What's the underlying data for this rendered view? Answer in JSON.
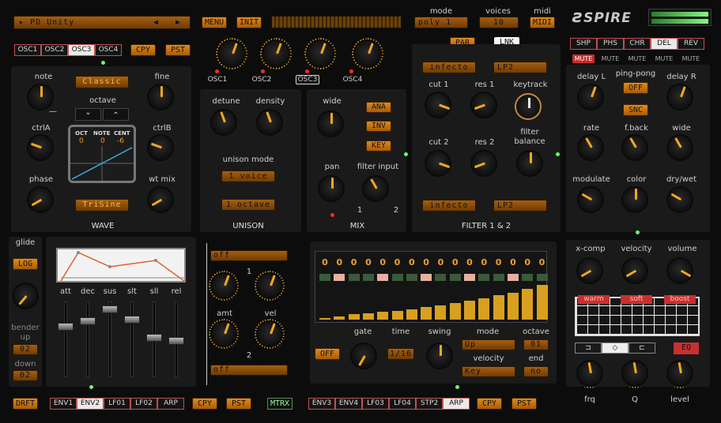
{
  "header": {
    "preset": "PD Unity",
    "menu": "MENU",
    "init": "INIT",
    "mode_label": "mode",
    "mode_value": "poly 1",
    "voices_label": "voices",
    "voices_value": "10",
    "midi_label": "midi",
    "midi_value": "MIDI",
    "logo": "SPIRE"
  },
  "osc": {
    "tabs": [
      "OSC1",
      "OSC2",
      "OSC3",
      "OSC4"
    ],
    "selected": 2,
    "copy": "CPY",
    "paste": "PST",
    "note": "note",
    "classic": "Classic",
    "fine": "fine",
    "octave": "octave",
    "ctrlA": "ctrlA",
    "ctrlB": "ctrlB",
    "phase": "phase",
    "wtmix": "wt mix",
    "trisine": "TriSine",
    "wave": "WAVE",
    "oct_h": "OCT",
    "note_h": "NOTE",
    "cent_h": "CENT",
    "oct_v": "0",
    "note_v": "0",
    "cent_v": "-6",
    "down_arrow": "⌄",
    "up_arrow": "⌃",
    "dash": "—"
  },
  "osc_sel": {
    "labels": [
      "OSC1",
      "OSC2",
      "OSC3",
      "OSC4"
    ]
  },
  "unison": {
    "detune": "detune",
    "density": "density",
    "mode_label": "unison mode",
    "voice": "1 voice",
    "octave": "1 octave",
    "title": "UNISON"
  },
  "mix": {
    "wide": "wide",
    "ana": "ANA",
    "inv": "INV",
    "key": "KEY",
    "pan": "pan",
    "filter_input": "filter input",
    "one": "1",
    "two": "2",
    "title": "MIX"
  },
  "filter": {
    "par": "PAR",
    "lnk": "LNK",
    "type1": "infecto",
    "mode1": "LP2",
    "cut1": "cut 1",
    "res1": "res 1",
    "keytrack": "keytrack",
    "cut2": "cut 2",
    "res2": "res 2",
    "filter_balance": "filter balance",
    "type2": "infecto",
    "mode2": "LP2",
    "title": "FILTER 1 & 2"
  },
  "fx": {
    "tabs": [
      "SHP",
      "PHS",
      "CHR",
      "DEL",
      "REV"
    ],
    "selected": 3,
    "mute_labels": [
      "MUTE",
      "MUTE",
      "MUTE",
      "MUTE",
      "MUTE"
    ],
    "delayL": "delay L",
    "pingpong": "ping-pong",
    "delayR": "delay R",
    "off": "OFF",
    "snc": "SNC",
    "rate": "rate",
    "fback": "f.back",
    "wide": "wide",
    "modulate": "modulate",
    "color": "color",
    "drywet": "dry/wet"
  },
  "env": {
    "glide": "glide",
    "log": "LOG",
    "bender_up": "bender up",
    "up_val": "02",
    "down": "down",
    "down_val": "02",
    "labels": [
      "att",
      "dec",
      "sus",
      "slt",
      "sll",
      "rel"
    ],
    "levels": [
      0.3,
      0.22,
      0.05,
      0.2,
      0.45,
      0.5
    ],
    "drft": "DRFT",
    "tabs": [
      "ENV1",
      "ENV2",
      "LF01",
      "LF02",
      "ARP"
    ],
    "selected": 1,
    "copy": "CPY",
    "paste": "PST",
    "mtrx": "MTRX"
  },
  "velmod": {
    "top": "off",
    "one": "1",
    "amt": "amt",
    "vel": "vel",
    "two": "2",
    "bottom": "off"
  },
  "arp": {
    "values": [
      "0",
      "0",
      "0",
      "0",
      "0",
      "0",
      "0",
      "0",
      "0",
      "0",
      "0",
      "0",
      "0",
      "0",
      "0",
      "0"
    ],
    "bars": [
      0.05,
      0.1,
      0.15,
      0.18,
      0.22,
      0.26,
      0.3,
      0.36,
      0.42,
      0.48,
      0.54,
      0.62,
      0.7,
      0.78,
      0.88,
      1.0
    ],
    "off": "OFF",
    "gate": "gate",
    "time": "time",
    "time_val": "1/16",
    "swing": "swing",
    "mode": "mode",
    "mode_val": "Up",
    "octave": "octave",
    "octave_val": "01",
    "velocity": "velocity",
    "vel_val": "Key",
    "end": "end",
    "end_val": "no",
    "tabs": [
      "ENV3",
      "ENV4",
      "LF03",
      "LF04",
      "STP2",
      "ARP"
    ],
    "selected": 5,
    "copy": "CPY",
    "paste": "PST"
  },
  "eq": {
    "xcomp": "x-comp",
    "velocity": "velocity",
    "volume": "volume",
    "warm": "warm",
    "soft": "soft",
    "boost": "boost",
    "eq": "EQ",
    "frq": "frq",
    "q": "Q",
    "level": "level"
  }
}
